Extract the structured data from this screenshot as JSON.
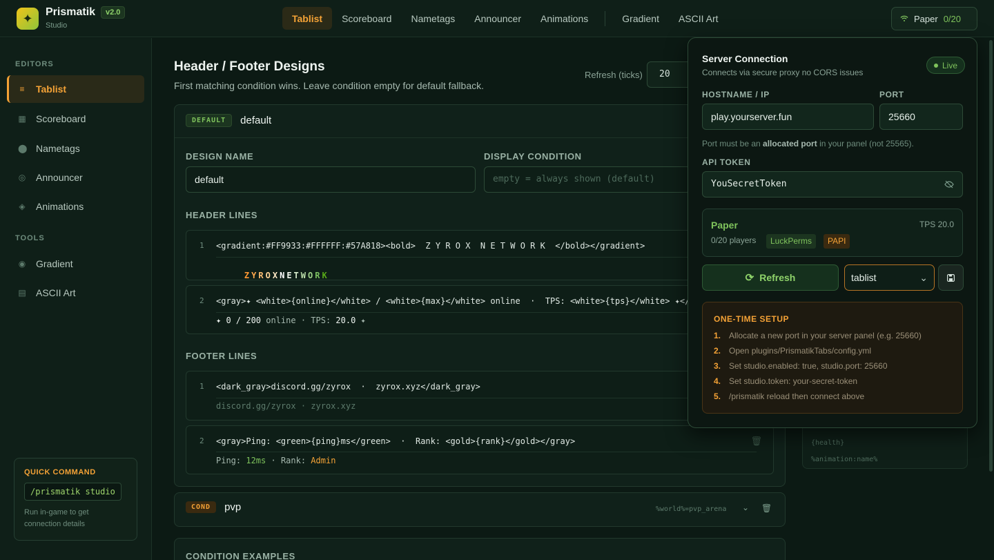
{
  "brand": {
    "name": "Prismatik",
    "version": "v2.0",
    "sub": "Studio"
  },
  "nav": [
    "Tablist",
    "Scoreboard",
    "Nametags",
    "Announcer",
    "Animations",
    "Gradient",
    "ASCII Art"
  ],
  "server_button": {
    "label": "Paper",
    "count": "0/20"
  },
  "sidebar": {
    "editors_label": "EDITORS",
    "editors": [
      "Tablist",
      "Scoreboard",
      "Nametags",
      "Announcer",
      "Animations"
    ],
    "tools_label": "TOOLS",
    "tools": [
      "Gradient",
      "ASCII Art"
    ],
    "quick": {
      "title": "QUICK COMMAND",
      "command": "/prismatik studio",
      "desc": "Run in-game to get connection details"
    }
  },
  "main": {
    "title": "Header / Footer Designs",
    "subtitle": "First matching condition wins. Leave condition empty for default fallback.",
    "refresh_label": "Refresh (ticks)",
    "refresh_value": "20",
    "default_card": {
      "tag": "DEFAULT",
      "name": "default",
      "design_name_label": "DESIGN NAME",
      "design_name_value": "default",
      "display_condition_label": "DISPLAY CONDITION",
      "display_condition_placeholder": "empty = always shown (default)",
      "header_label": "HEADER LINES",
      "footer_label": "FOOTER LINES",
      "header_lines": [
        {
          "num": "1",
          "code": "<gradient:#FF9933:#FFFFFF:#57A818><bold>  Z Y R O X  N E T W O R K  </bold></gradient>"
        },
        {
          "num": "2",
          "code": "<gray>✦ <white>{online}</white> / <white>{max}</white> online  ·  TPS: <white>{tps}</white> ✦</",
          "preview": {
            "a": "✦ 0 / 200",
            "b": " online · TPS: ",
            "c": "20.0",
            "d": " ✦"
          }
        }
      ],
      "footer_lines": [
        {
          "num": "1",
          "code": "<dark_gray>discord.gg/zyrox  ·  zyrox.xyz</dark_gray>",
          "preview": "discord.gg/zyrox · zyrox.xyz"
        },
        {
          "num": "2",
          "code": "<gray>Ping: <green>{ping}ms</green>  ·  Rank: <gold>{rank}</gold></gray>",
          "preview": {
            "a": "Ping: ",
            "b": "12ms",
            "c": " · Rank: ",
            "d": "Admin"
          }
        }
      ],
      "gradient_preview": [
        "Z",
        "Y",
        "R",
        "O",
        "X",
        "N",
        "E",
        "T",
        "W",
        "O",
        "R",
        "K"
      ]
    },
    "pvp_card": {
      "tag": "COND",
      "name": "pvp",
      "condition": "%world%=pvp_arena"
    },
    "examples_label": "CONDITION EXAMPLES",
    "bg_panel": [
      "{health}",
      "%animation:name%"
    ]
  },
  "popup": {
    "title": "Server Connection",
    "subtitle": "Connects via secure proxy no CORS issues",
    "live": "Live",
    "host_label": "HOSTNAME / IP",
    "host_value": "play.yourserver.fun",
    "port_label": "PORT",
    "port_value": "25660",
    "hint_a": "Port must be an ",
    "hint_b": "allocated port",
    "hint_c": " in your panel (not 25565).",
    "token_label": "API TOKEN",
    "token_value": "YouSecretToken",
    "status": {
      "name": "Paper",
      "tps": "TPS 20.0",
      "players": "0/20 players",
      "plugins": [
        "LuckPerms",
        "PAPI"
      ]
    },
    "refresh": "Refresh",
    "select_value": "tablist",
    "setup_title": "ONE-TIME SETUP",
    "steps": [
      {
        "n": "1.",
        "t": "Allocate a new port in your server panel (e.g. 25660)"
      },
      {
        "n": "2.",
        "t": "Open plugins/PrismatikTabs/config.yml"
      },
      {
        "n": "3.",
        "t": "Set studio.enabled: true, studio.port: 25660"
      },
      {
        "n": "4.",
        "t": "Set studio.token: your-secret-token"
      },
      {
        "n": "5.",
        "t": "/prismatik reload then connect above"
      }
    ]
  },
  "colors": {
    "accent": "#f4a236",
    "green": "#7fc35c",
    "bg": "#0c1a14"
  }
}
